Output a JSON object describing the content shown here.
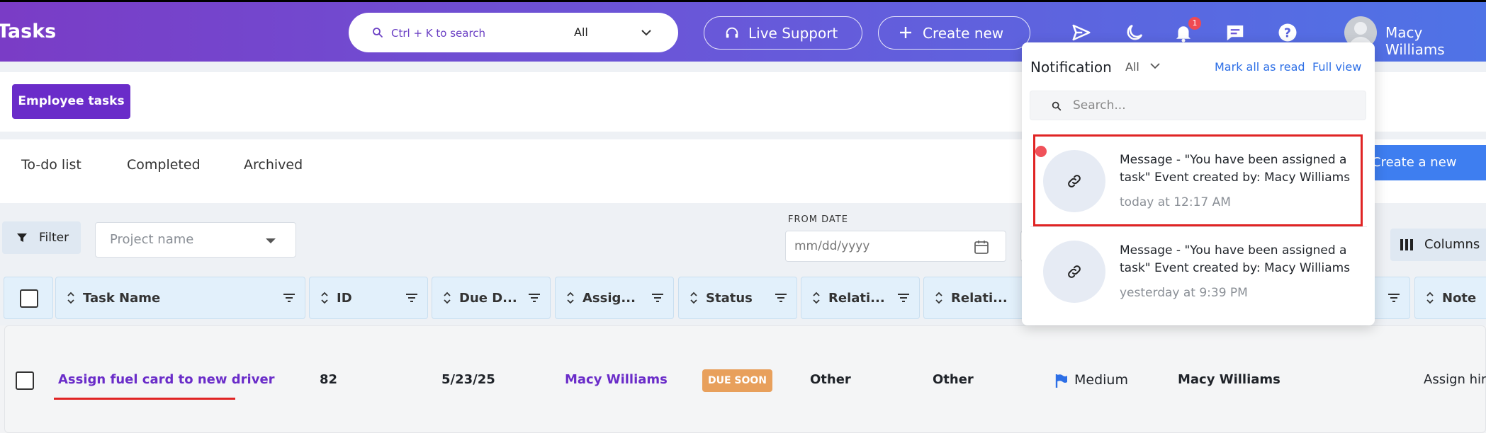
{
  "header": {
    "app_title": "Tasks",
    "search": {
      "placeholder": "Ctrl + K to search",
      "scope": "All"
    },
    "live_support": "Live Support",
    "create_new": "Create new",
    "notification_count": "1",
    "user_name": "Macy Williams",
    "colors": {
      "gradient_start": "#7a3cc6",
      "gradient_end": "#4f73e6"
    }
  },
  "toolbar": {
    "employee_tasks": "Employee tasks"
  },
  "tabs": [
    "To-do list",
    "Completed",
    "Archived"
  ],
  "create_task": "Create a new Task",
  "filters": {
    "filter_label": "Filter",
    "project_placeholder": "Project name",
    "from_date_label": "FROM DATE",
    "date_placeholder": "mm/dd/yyyy",
    "columns_label": "Columns"
  },
  "table": {
    "headers": [
      "Task Name",
      "ID",
      "Due D...",
      "Assig...",
      "Status",
      "Relati...",
      "Relati...",
      "Note"
    ],
    "rows": [
      {
        "task_name": "Assign fuel card to new driver",
        "id": "82",
        "due_date": "5/23/25",
        "assignee": "Macy Williams",
        "status": "DUE SOON",
        "related1": "Other",
        "related2": "Other",
        "priority": "Medium",
        "created_by": "Macy Williams",
        "note": "Assign him"
      }
    ]
  },
  "notifications": {
    "title": "Notification",
    "scope": "All",
    "mark_all_read": "Mark all as read",
    "full_view": "Full view",
    "search_placeholder": "Search...",
    "items": [
      {
        "message": "Message - \"You have been assigned a task\" Event created by: Macy Williams",
        "time": "today at 12:17 AM",
        "unread": true
      },
      {
        "message": "Message - \"You have been assigned a task\" Event created by: Macy Williams",
        "time": "yesterday at 9:39 PM",
        "unread": false
      }
    ]
  },
  "icons": [
    "search-icon",
    "chevron-down-icon",
    "headset-icon",
    "plus-icon",
    "send-icon",
    "moon-icon",
    "bell-icon",
    "chat-icon",
    "help-icon",
    "filter-icon",
    "calendar-icon",
    "columns-icon",
    "link-icon",
    "flag-icon",
    "sort-icon"
  ]
}
